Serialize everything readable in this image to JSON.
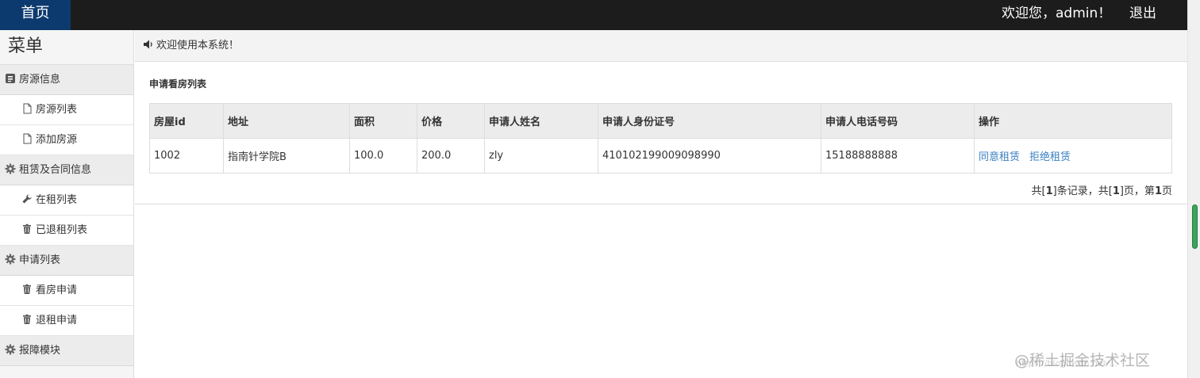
{
  "header": {
    "home_label": "首页",
    "welcome_text": "欢迎您，admin！",
    "logout_label": "退出"
  },
  "sidebar": {
    "title": "菜单",
    "groups": [
      {
        "label": "房源信息",
        "icon": "list-box-icon",
        "items": [
          {
            "label": "房源列表",
            "icon": "document-icon"
          },
          {
            "label": "添加房源",
            "icon": "document-icon"
          }
        ]
      },
      {
        "label": "租赁及合同信息",
        "icon": "gear-icon",
        "items": [
          {
            "label": "在租列表",
            "icon": "wrench-icon"
          },
          {
            "label": "已退租列表",
            "icon": "trash-icon"
          }
        ]
      },
      {
        "label": "申请列表",
        "icon": "gear-icon",
        "items": [
          {
            "label": "看房申请",
            "icon": "trash-icon"
          },
          {
            "label": "退租申请",
            "icon": "trash-icon"
          }
        ]
      },
      {
        "label": "报障模块",
        "icon": "gear-icon",
        "items": []
      }
    ]
  },
  "notice": {
    "text": "欢迎使用本系统！",
    "icon": "speaker-icon"
  },
  "main": {
    "section_title": "申请看房列表",
    "table": {
      "columns": [
        "房屋id",
        "地址",
        "面积",
        "价格",
        "申请人姓名",
        "申请人身份证号",
        "申请人电话号码",
        "操作"
      ],
      "rows": [
        {
          "id": "1002",
          "address": "指南针学院B",
          "area": "100.0",
          "price": "200.0",
          "name": "zly",
          "id_card": "410102199009098990",
          "phone": "15188888888",
          "agree": "同意租赁",
          "reject": "拒绝租赁"
        }
      ]
    },
    "pager": {
      "prefix": "共[",
      "total": "1",
      "mid1": "]条记录，共[",
      "pages": "1",
      "mid2": "]页，第",
      "current": "1",
      "suffix": "页"
    }
  },
  "watermark": {
    "text": "@稀土掘金技术社区",
    "url": "https://blog.csdn.net/..."
  },
  "colors": {
    "topbar": "#1c1c1c",
    "home_tab": "#0d3a6e",
    "link": "#3a7fc1",
    "sidebar_bg": "#f5f5f5"
  }
}
